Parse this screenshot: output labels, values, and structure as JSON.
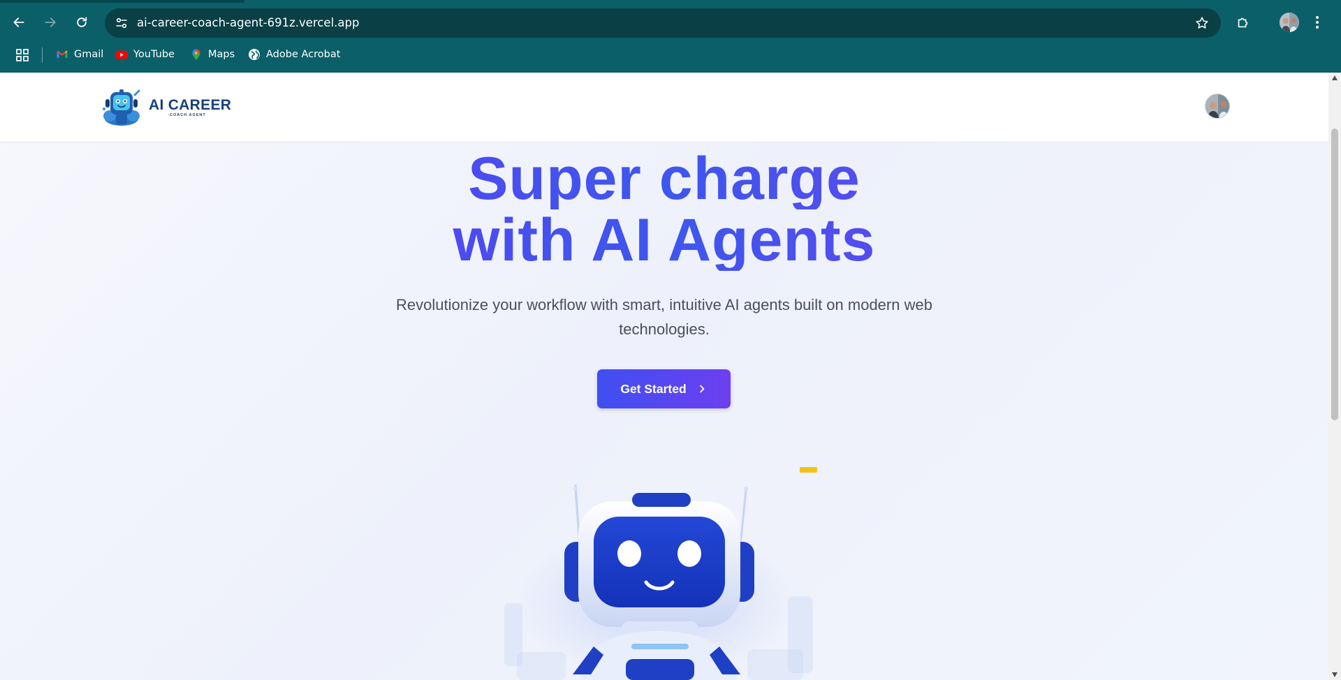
{
  "browser": {
    "url": "ai-career-coach-agent-691z.vercel.app",
    "bookmarks": [
      {
        "label": "Gmail",
        "icon": "gmail-icon"
      },
      {
        "label": "YouTube",
        "icon": "youtube-icon"
      },
      {
        "label": "Maps",
        "icon": "maps-icon"
      },
      {
        "label": "Adobe Acrobat",
        "icon": "globe-icon"
      }
    ]
  },
  "site": {
    "logo": {
      "title": "AI CAREER",
      "subtitle": "COACH AGENT"
    },
    "hero": {
      "title_line1": "Super charge",
      "title_line2": "with AI Agents",
      "subtitle": "Revolutionize your workflow with smart, intuitive AI agents built on modern web technologies.",
      "cta_label": "Get Started"
    }
  },
  "colors": {
    "chrome": "#0b5f68",
    "omnibox": "#0a3f46",
    "accent_start": "#3f4ff0",
    "accent_end": "#6d3ff0",
    "logo_text": "#17407a"
  }
}
